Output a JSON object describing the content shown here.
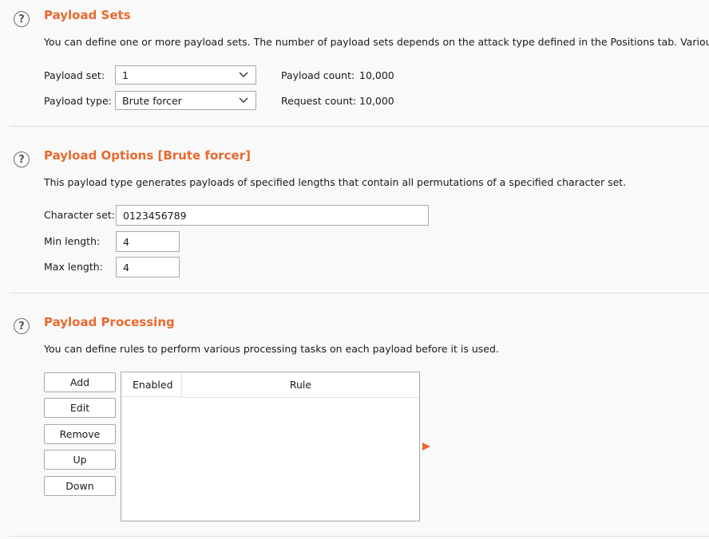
{
  "payload_sets": {
    "title": "Payload Sets",
    "description": "You can define one or more payload sets. The number of payload sets depends on the attack type defined in the Positions tab. Various p",
    "payload_set_label": "Payload set:",
    "payload_set_value": "1",
    "payload_type_label": "Payload type:",
    "payload_type_value": "Brute forcer",
    "payload_count_label": "Payload count:",
    "payload_count_value": "10,000",
    "request_count_label": "Request count:",
    "request_count_value": "10,000"
  },
  "payload_options": {
    "title": "Payload Options [Brute forcer]",
    "description": "This payload type generates payloads of specified lengths that contain all permutations of a specified character set.",
    "character_set_label": "Character set:",
    "character_set_value": "0123456789",
    "min_length_label": "Min length:",
    "min_length_value": "4",
    "max_length_label": "Max length:",
    "max_length_value": "4"
  },
  "payload_processing": {
    "title": "Payload Processing",
    "description": "You can define rules to perform various processing tasks on each payload before it is used.",
    "buttons": {
      "add": "Add",
      "edit": "Edit",
      "remove": "Remove",
      "up": "Up",
      "down": "Down"
    },
    "table": {
      "columns": [
        "Enabled",
        "Rule"
      ],
      "rows": []
    }
  },
  "icons": {
    "help": "?",
    "expand_arrow_color": "#e8692f"
  },
  "colors": {
    "accent": "#e8692f"
  }
}
